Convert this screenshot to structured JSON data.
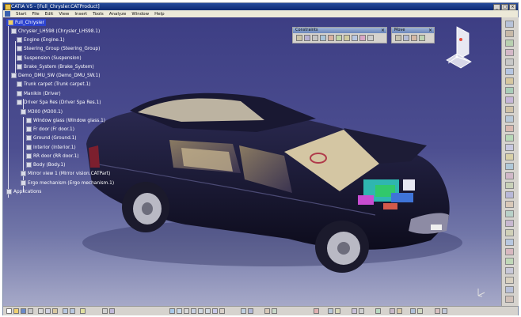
{
  "window": {
    "title": "CATIA V5 - [Full_Chrysler.CATProduct]"
  },
  "menu": [
    "Start",
    "File",
    "Edit",
    "View",
    "Insert",
    "Tools",
    "Analyze",
    "Window",
    "Help"
  ],
  "panels": {
    "constraints": {
      "title": "Constraints"
    },
    "move": {
      "title": "Move"
    }
  },
  "tree": {
    "root": "Full_Chrysler",
    "items": [
      "Chrysler_LHS98 (Chrysler_LHS98.1)",
      "Engine (Engine.1)",
      "Steering_Group (Steering_Group)",
      "Suspension (Suspension)",
      "Brake_System (Brake_System)",
      "Demo_DMU_SW (Demo_DMU_SW.1)",
      "Trunk carpet (Trunk carpet.1)",
      "Manikin (Driver)",
      "Driver Spa Res (Driver Spa Res.1)",
      "M300 (M300.1)",
      "Window glass (Window glass.1)",
      "Fr door (Fr door.1)",
      "Ground (Ground.1)",
      "Interior (Interior.1)",
      "RR door (RR door.1)",
      "Body (Body.1)",
      "Mirror view 1 (Mirror vision.CATPart)",
      "Ergo mechanism (Ergo mechanism.1)",
      "Applications"
    ]
  },
  "colors": {
    "background_top": "#3d3e84",
    "background_bottom": "#a6a9c8",
    "car_body": "#15132a",
    "selection": "#2d44d0"
  }
}
